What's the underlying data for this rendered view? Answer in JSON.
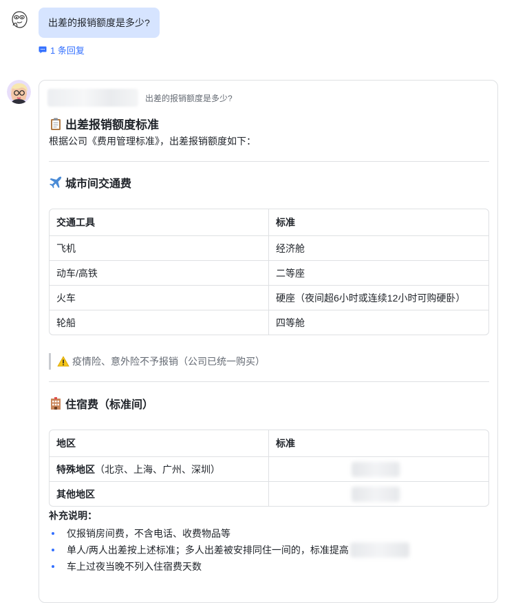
{
  "question": {
    "text": "出差的报销额度是多少?",
    "avatar_icon": "doodle-face-icon"
  },
  "reply": {
    "label": "1 条回复",
    "icon": "comment-icon",
    "color": "#3370ff"
  },
  "answer": {
    "avatar_icon": "assistant-avatar",
    "quote_text": "出差的报销额度是多少?",
    "title_icon": "clipboard-icon",
    "title": "出差报销额度标准",
    "intro": "根据公司《费用管理标准》，出差报销额度如下：",
    "transport": {
      "icon": "airplane-icon",
      "heading": "城市间交通费",
      "headers": [
        "交通工具",
        "标准"
      ],
      "rows": [
        [
          "飞机",
          "经济舱"
        ],
        [
          "动车/高铁",
          "二等座"
        ],
        [
          "火车",
          "硬座（夜间超6小时或连续12小时可购硬卧）"
        ],
        [
          "轮船",
          "四等舱"
        ]
      ],
      "note_icon": "warning-icon",
      "note": "疫情险、意外险不予报销（公司已统一购买）"
    },
    "lodging": {
      "icon": "hotel-icon",
      "heading": "住宿费（标准间）",
      "headers": [
        "地区",
        "标准"
      ],
      "rows": [
        {
          "region_bold": "特殊地区",
          "region_rest": "（北京、上海、广州、深圳）"
        },
        {
          "region_bold": "其他地区",
          "region_rest": ""
        }
      ]
    },
    "supplement": {
      "title": "补充说明：",
      "items": [
        "仅报销房间费，不含电话、收费物品等",
        "单人/两人出差按上述标准；多人出差被安排同住一间的，标准提高",
        "车上过夜当晚不列入住宿费天数"
      ]
    }
  }
}
